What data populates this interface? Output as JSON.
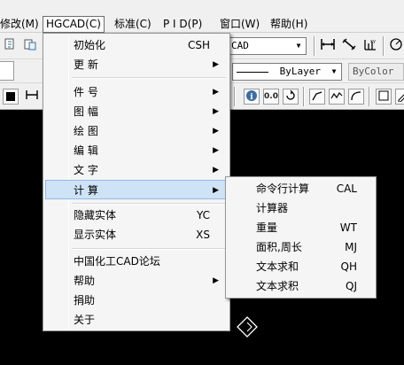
{
  "menubar": {
    "items": [
      "修改(M)",
      "HGCAD(C)",
      "标准(C)",
      "P I D(P)",
      "窗口(W)",
      "帮助(H)"
    ]
  },
  "toolbar": {
    "style_combo": "CAD",
    "linetype_combo": "ByLayer",
    "color_combo": "ByColor",
    "value_button_1": "0.0"
  },
  "hgcad_menu": {
    "items": [
      {
        "label": "初始化",
        "shortcut": "CSH"
      },
      {
        "label": "更  新",
        "shortcut": ""
      },
      {
        "label": "件  号",
        "shortcut": ""
      },
      {
        "label": "图  幅",
        "shortcut": ""
      },
      {
        "label": "绘  图",
        "shortcut": ""
      },
      {
        "label": "编  辑",
        "shortcut": ""
      },
      {
        "label": "文  字",
        "shortcut": ""
      },
      {
        "label": "计  算",
        "shortcut": ""
      },
      {
        "label": "隐藏实体",
        "shortcut": "YC"
      },
      {
        "label": "显示实体",
        "shortcut": "XS"
      },
      {
        "label": "中国化工CAD论坛",
        "shortcut": ""
      },
      {
        "label": "帮助",
        "shortcut": ""
      },
      {
        "label": "捐助",
        "shortcut": ""
      },
      {
        "label": "关于",
        "shortcut": ""
      }
    ]
  },
  "calc_submenu": {
    "items": [
      {
        "label": "命令行计算",
        "shortcut": "CAL"
      },
      {
        "label": "计算器",
        "shortcut": ""
      },
      {
        "label": "重量",
        "shortcut": "WT"
      },
      {
        "label": "面积,周长",
        "shortcut": "MJ"
      },
      {
        "label": "文本求和",
        "shortcut": "QH"
      },
      {
        "label": "文本求积",
        "shortcut": "QJ"
      }
    ]
  },
  "colors": {
    "menu_bg": "#f5f5f5",
    "highlight": "#cfe3f7",
    "canvas": "#000000"
  }
}
